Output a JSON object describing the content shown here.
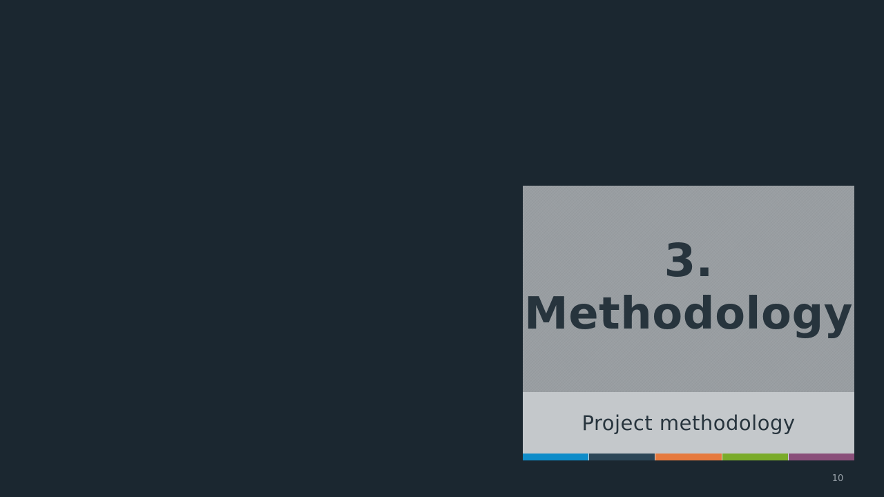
{
  "slide": {
    "section_number": "3.",
    "section_title": "Methodology",
    "subtitle": "Project methodology",
    "page_number": "10"
  },
  "colors": {
    "background": "#1b2730",
    "title_panel": "#999ea2",
    "subtitle_panel": "#c4c8cb",
    "text": "#27343d",
    "accent_bar": [
      "#0e8cc9",
      "#2c4657",
      "#e67a3e",
      "#7aab2a",
      "#8a4f7a"
    ]
  }
}
